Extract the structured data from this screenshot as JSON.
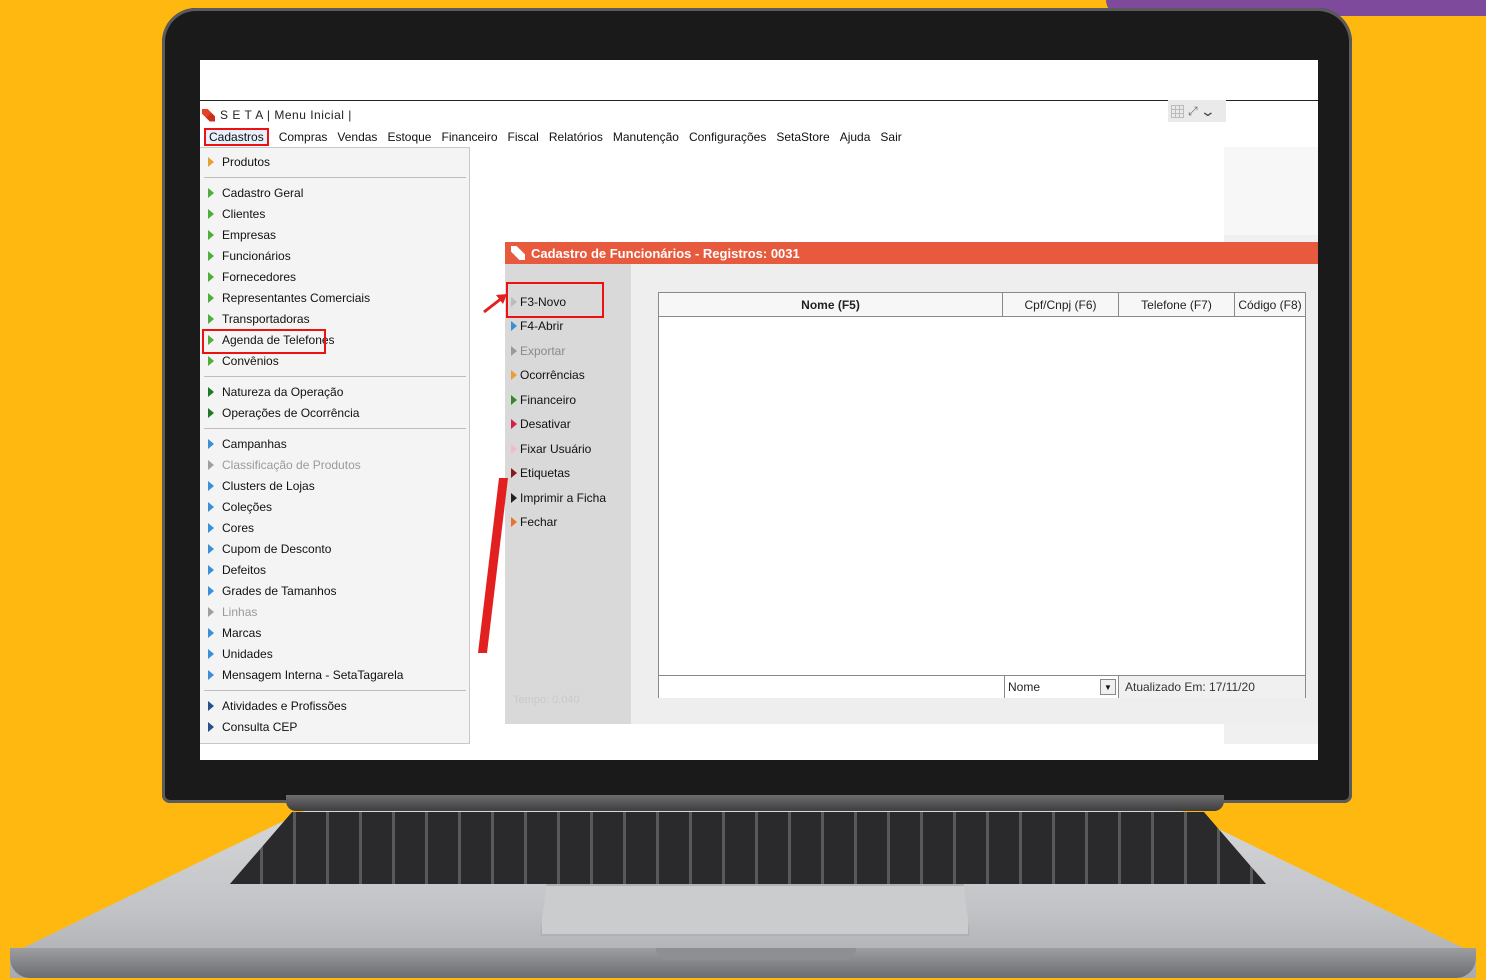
{
  "app": {
    "title": "S E T A | Menu Inicial |"
  },
  "menubar": [
    "Cadastros",
    "Compras",
    "Vendas",
    "Estoque",
    "Financeiro",
    "Fiscal",
    "Relatórios",
    "Manutenção",
    "Configurações",
    "SetaStore",
    "Ajuda",
    "Sair"
  ],
  "dropdown": {
    "items": [
      {
        "label": "Produtos",
        "color": "#e7a036"
      },
      {
        "label": "Cadastro Geral",
        "color": "#4fae3a"
      },
      {
        "label": "Clientes",
        "color": "#4fae3a"
      },
      {
        "label": "Empresas",
        "color": "#4fae3a"
      },
      {
        "label": "Funcionários",
        "color": "#4fae3a"
      },
      {
        "label": "Fornecedores",
        "color": "#4fae3a"
      },
      {
        "label": "Representantes Comerciais",
        "color": "#4fae3a"
      },
      {
        "label": "Transportadoras",
        "color": "#4fae3a"
      },
      {
        "label": "Agenda de Telefones",
        "color": "#4fae3a"
      },
      {
        "label": "Convênios",
        "color": "#4fae3a"
      },
      {
        "label": "Natureza da Operação",
        "color": "#1e7a2a"
      },
      {
        "label": "Operações de Ocorrência",
        "color": "#1e7a2a"
      },
      {
        "label": "Campanhas",
        "color": "#3b8fd6"
      },
      {
        "label": "Classificação de Produtos",
        "color": "#a0a0a0",
        "disabled": true
      },
      {
        "label": "Clusters de Lojas",
        "color": "#3b8fd6"
      },
      {
        "label": "Coleções",
        "color": "#3b8fd6"
      },
      {
        "label": "Cores",
        "color": "#3b8fd6"
      },
      {
        "label": "Cupom de Desconto",
        "color": "#3b8fd6"
      },
      {
        "label": "Defeitos",
        "color": "#3b8fd6"
      },
      {
        "label": "Grades de Tamanhos",
        "color": "#3b8fd6"
      },
      {
        "label": "Linhas",
        "color": "#a0a0a0",
        "disabled": true
      },
      {
        "label": "Marcas",
        "color": "#3b8fd6"
      },
      {
        "label": "Unidades",
        "color": "#3b8fd6"
      },
      {
        "label": "Mensagem Interna - SetaTagarela",
        "color": "#3b8fd6"
      },
      {
        "label": "Atividades e Profissões",
        "color": "#2b4f8a"
      },
      {
        "label": "Consulta CEP",
        "color": "#2b4f8a"
      }
    ]
  },
  "window": {
    "title": "Cadastro de Funcionários - Registros: 0031",
    "actions": [
      {
        "label": "F3-Novo",
        "color": "#bbbbbb"
      },
      {
        "label": "F4-Abrir",
        "color": "#3b8fd6"
      },
      {
        "label": "Exportar",
        "color": "#9a9a9a",
        "disabled": true
      },
      {
        "label": "Ocorrências",
        "color": "#e7a036"
      },
      {
        "label": "Financeiro",
        "color": "#2f8a2f"
      },
      {
        "label": "Desativar",
        "color": "#d6204a"
      },
      {
        "label": "Fixar Usuário",
        "color": "#f2b8d6"
      },
      {
        "label": "Etiquetas",
        "color": "#8a1a1a"
      },
      {
        "label": "Imprimir a Ficha",
        "color": "#222222"
      },
      {
        "label": "Fechar",
        "color": "#e8742a"
      }
    ],
    "tempo": "Tempo: 0,040",
    "grid": {
      "columns": [
        "Nome (F5)",
        "Cpf/Cnpj (F6)",
        "Telefone (F7)",
        "Código (F8)"
      ],
      "search_field": "Nome",
      "status": "Atualizado Em: 17/11/20"
    }
  },
  "colors": {
    "background": "#ffb80f",
    "window_title": "#e85a3d",
    "highlight": "#e11111"
  }
}
